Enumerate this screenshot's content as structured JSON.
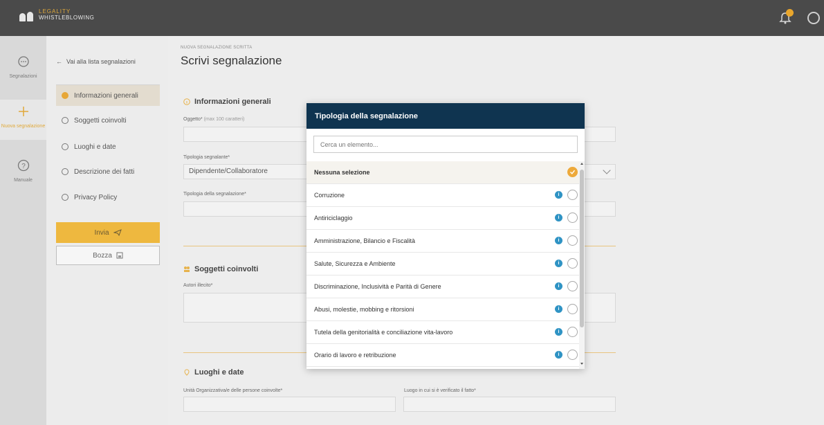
{
  "header": {
    "logo": {
      "brand": "LEGALITY",
      "product": "WHISTLEBLOWING",
      "tagline": ""
    },
    "colors": {
      "bar": "#4a4a4a",
      "accent": "#e9a62c"
    },
    "icons": [
      "notification-bell-icon",
      "user-account-icon"
    ]
  },
  "rail": {
    "items": [
      {
        "label": "Segnalazioni",
        "icon": "speech-bubble-icon"
      },
      {
        "label": "Nuova segnalazione",
        "icon": "plus-icon"
      },
      {
        "label": "Manuale",
        "icon": "question-circle-icon"
      }
    ]
  },
  "nav": {
    "back_link": "Vai alla lista segnalazioni",
    "steps": [
      {
        "label": "Informazioni generali"
      },
      {
        "label": "Soggetti coinvolti"
      },
      {
        "label": "Luoghi e date"
      },
      {
        "label": "Descrizione dei fatti"
      },
      {
        "label": "Privacy Policy"
      }
    ],
    "send_button": "Invia",
    "draft_button": "Bozza"
  },
  "main": {
    "breadcrumb": "NUOVA SEGNALAZIONE SCRITTA",
    "title": "Scrivi segnalazione",
    "sections": {
      "general": {
        "title": "Informazioni generali",
        "subject_label": "Oggetto*",
        "subject_hint": "(max 100 caratteri)",
        "reporter_type_label": "Tipologia segnalante*",
        "reporter_type_value": "Dipendente/Collaboratore",
        "report_type_label": "Tipologia della segnalazione*"
      },
      "subjects": {
        "title": "Soggetti coinvolti",
        "authors_label": "Autori illecito*"
      },
      "places": {
        "title": "Luoghi e date",
        "org_unit_label": "Unità Organizzativa/e delle persone coinvolte*",
        "place_label": "Luogo in cui si è verificato il fatto*"
      }
    }
  },
  "modal": {
    "title": "Tipologia della segnalazione",
    "search_placeholder": "Cerca un elemento...",
    "header_color": "#0f3450",
    "options": [
      {
        "label": "Nessuna selezione",
        "selected": true,
        "info": false
      },
      {
        "label": "Corruzione",
        "selected": false,
        "info": true
      },
      {
        "label": "Antiriciclaggio",
        "selected": false,
        "info": true
      },
      {
        "label": "Amministrazione, Bilancio e Fiscalità",
        "selected": false,
        "info": true
      },
      {
        "label": "Salute, Sicurezza e Ambiente",
        "selected": false,
        "info": true
      },
      {
        "label": "Discriminazione, Inclusività e Parità di Genere",
        "selected": false,
        "info": true
      },
      {
        "label": "Abusi, molestie, mobbing e ritorsioni",
        "selected": false,
        "info": true
      },
      {
        "label": "Tutela della genitorialità e conciliazione vita-lavoro",
        "selected": false,
        "info": true
      },
      {
        "label": "Orario di lavoro e retribuzione",
        "selected": false,
        "info": true
      }
    ]
  }
}
